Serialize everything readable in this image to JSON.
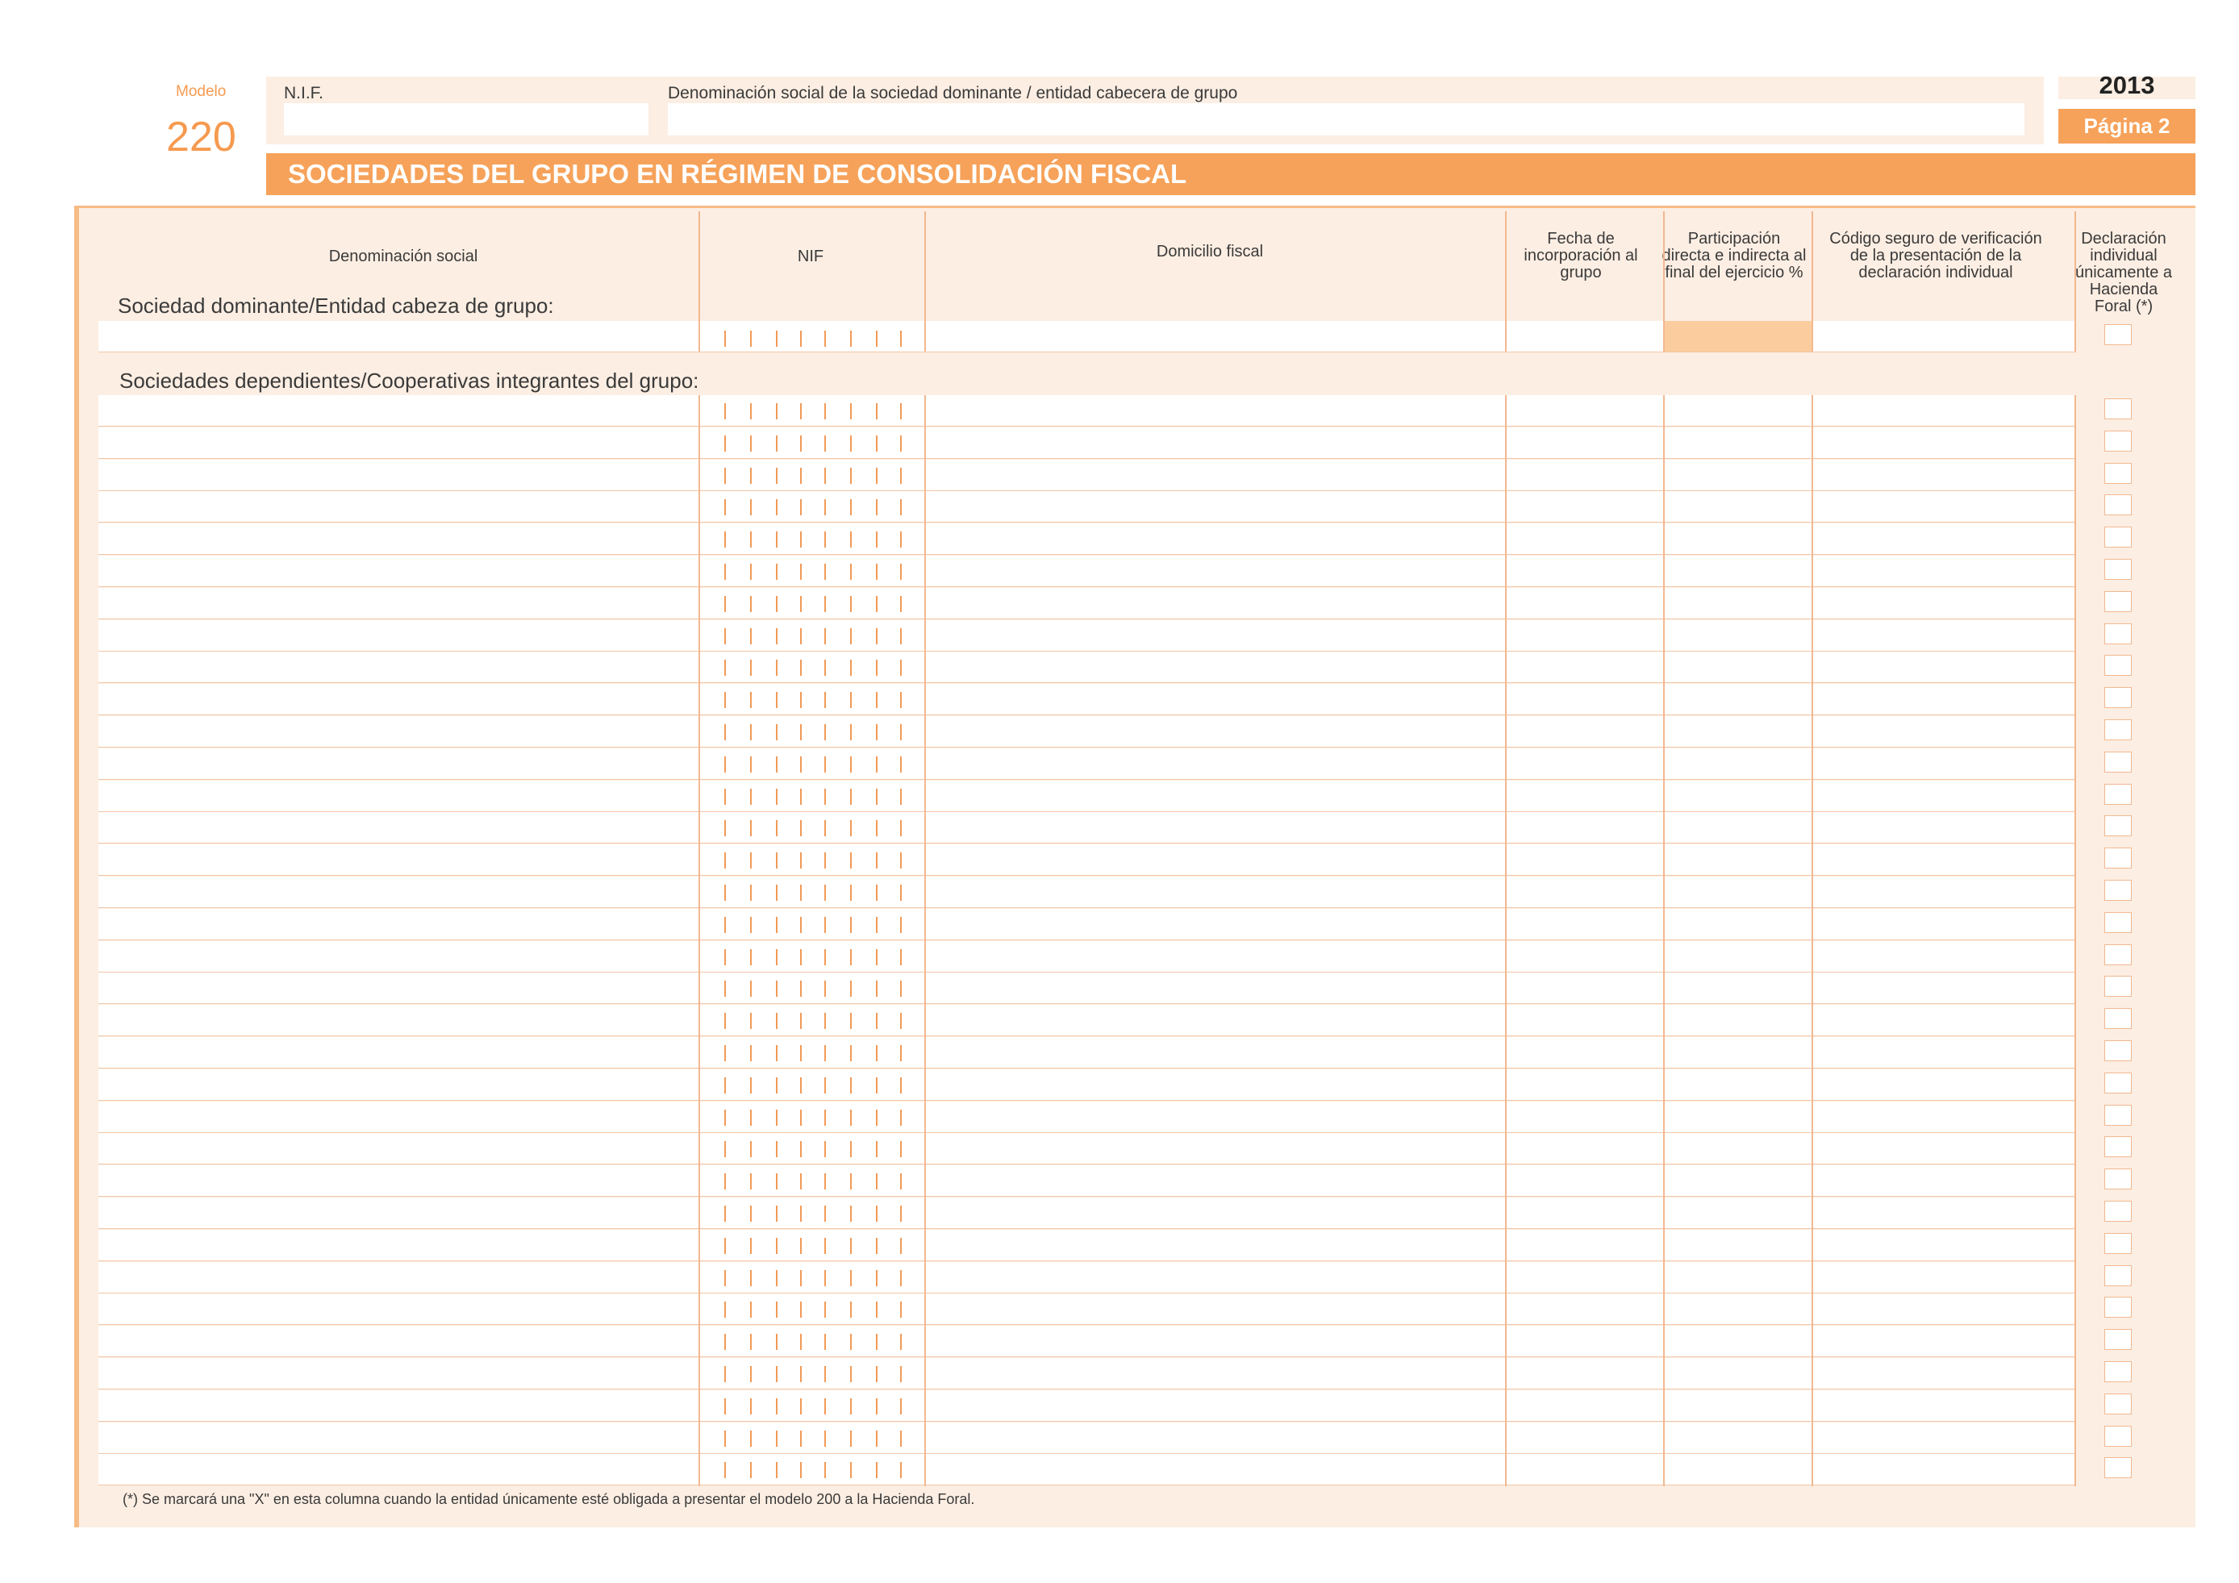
{
  "modelo": {
    "label": "Modelo",
    "number": "220"
  },
  "header": {
    "nif_label": "N.I.F.",
    "denominacion_label": "Denominación social de la sociedad dominante / entidad cabecera de grupo",
    "year": "2013",
    "page": "Página 2"
  },
  "title": "SOCIEDADES DEL GRUPO EN RÉGIMEN DE CONSOLIDACIÓN FISCAL",
  "table": {
    "columns": {
      "denominacion": "Denominación social",
      "nif": "NIF",
      "domicilio": "Domicilio fiscal",
      "fecha": "Fecha de incorporación al grupo",
      "participacion": "Participación directa e indirecta al final del ejercicio %",
      "codigo": "Código seguro de verificación de la presentación de la declaración individual",
      "declaracion": "Declaración individual únicamente a Hacienda Foral (*)"
    },
    "section_dominante": "Sociedad dominante/Entidad cabeza de grupo:",
    "section_dependientes": "Sociedades dependientes/Cooperativas integrantes del grupo:",
    "dependientes_row_count": 34
  },
  "footnote": "(*) Se marcará una \"X\" en esta columna cuando la entidad únicamente esté obligada a presentar el modelo 200 a la Hacienda Foral.",
  "colors": {
    "accent": "#f7a25a",
    "panel": "#fdeee3",
    "line": "#f2b890"
  }
}
